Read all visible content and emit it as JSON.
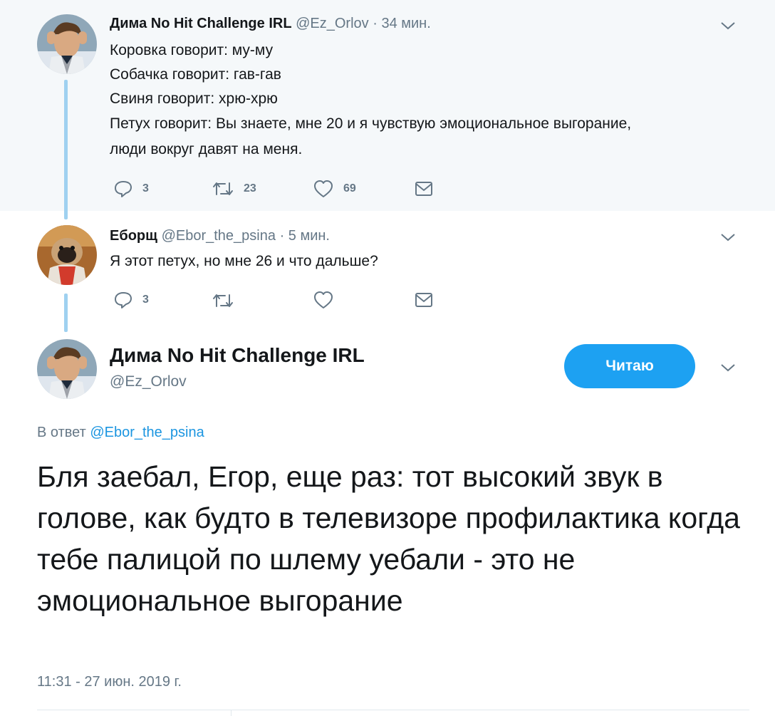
{
  "tweet1": {
    "author_name": "Дима No Hit Challenge IRL",
    "handle": "@Ez_Orlov",
    "time": "· 34 мин.",
    "lines": [
      "Коровка говорит: му-му",
      "Собачка говорит: гав-гав",
      "Свиня говорит: хрю-хрю",
      "Петух говорит: Вы знаете, мне 20 и я чувствую эмоциональное выгорание,",
      "люди вокруг давят на меня."
    ],
    "actions": {
      "replies": "3",
      "retweets": "23",
      "likes": "69"
    }
  },
  "tweet2": {
    "author_name": "Еборщ",
    "handle": "@Ebor_the_psina",
    "time": "· 5 мин.",
    "lines": [
      "Я этот петух, но мне 26 и что дальше?"
    ],
    "actions": {
      "replies": "3",
      "retweets": "",
      "likes": ""
    }
  },
  "main_tweet": {
    "author_name": "Дима No Hit Challenge IRL",
    "handle": "@Ez_Orlov",
    "follow_label": "Читаю",
    "reply_prefix": "В ответ",
    "reply_handle": "@Ebor_the_psina",
    "text": "Бля заебал, Егор, еще раз: тот высокий звук в голове, как будто в телевизоре профилактика когда тебе палицой по шлему уебали - это не эмоциональное выгорание",
    "timestamp": "11:31 - 27 июн. 2019 г."
  },
  "colors": {
    "accent": "#1da1f2",
    "link": "#1b95e0",
    "thread_line": "#9fd1f0",
    "muted": "#657786",
    "context_bg": "#f5f8fa"
  },
  "icons": [
    "reply-icon",
    "retweet-icon",
    "like-icon",
    "dm-icon",
    "chevron-down-icon"
  ]
}
